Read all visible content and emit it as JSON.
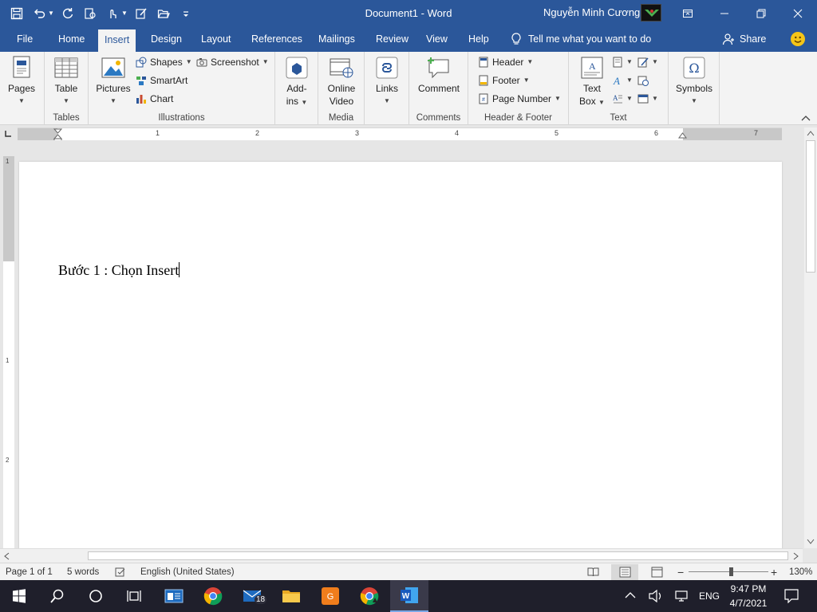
{
  "window": {
    "title": "Document1 - Word",
    "user_name": "Nguyễn Minh Cương"
  },
  "tabs": [
    {
      "label": "File"
    },
    {
      "label": "Home"
    },
    {
      "label": "Insert",
      "active": true
    },
    {
      "label": "Design"
    },
    {
      "label": "Layout"
    },
    {
      "label": "References"
    },
    {
      "label": "Mailings"
    },
    {
      "label": "Review"
    },
    {
      "label": "View"
    },
    {
      "label": "Help"
    }
  ],
  "tell_me": "Tell me what you want to do",
  "share": "Share",
  "ribbon": {
    "pages": {
      "label": "Pages"
    },
    "tables": {
      "table_label": "Table",
      "group": "Tables"
    },
    "illustrations": {
      "pictures": "Pictures",
      "shapes": "Shapes",
      "smartart": "SmartArt",
      "chart": "Chart",
      "screenshot": "Screenshot",
      "group": "Illustrations"
    },
    "addins": {
      "line1": "Add-",
      "line2": "ins"
    },
    "media": {
      "line1": "Online",
      "line2": "Video",
      "group": "Media"
    },
    "links": {
      "label": "Links"
    },
    "comments": {
      "label": "Comment",
      "group": "Comments"
    },
    "header_footer": {
      "header": "Header",
      "footer": "Footer",
      "page_number": "Page Number",
      "group": "Header & Footer"
    },
    "text": {
      "line1": "Text",
      "line2": "Box",
      "group": "Text"
    },
    "symbols": {
      "label": "Symbols"
    }
  },
  "ruler": {
    "numbers": [
      "1",
      "2",
      "3",
      "4",
      "5",
      "6",
      "7"
    ],
    "v_numbers": [
      "1",
      "1",
      "2"
    ]
  },
  "document": {
    "text": "Bước 1 : Chọn Insert"
  },
  "status": {
    "page": "Page 1 of 1",
    "words": "5 words",
    "language": "English (United States)",
    "zoom": "130%"
  },
  "taskbar": {
    "mail_badge": "18",
    "lang": "ENG",
    "time": "9:47 PM",
    "date": "4/7/2021"
  },
  "colors": {
    "accent": "#2b579a",
    "ribbon_bg": "#f3f3f3",
    "taskbar": "#1f1f2b"
  }
}
